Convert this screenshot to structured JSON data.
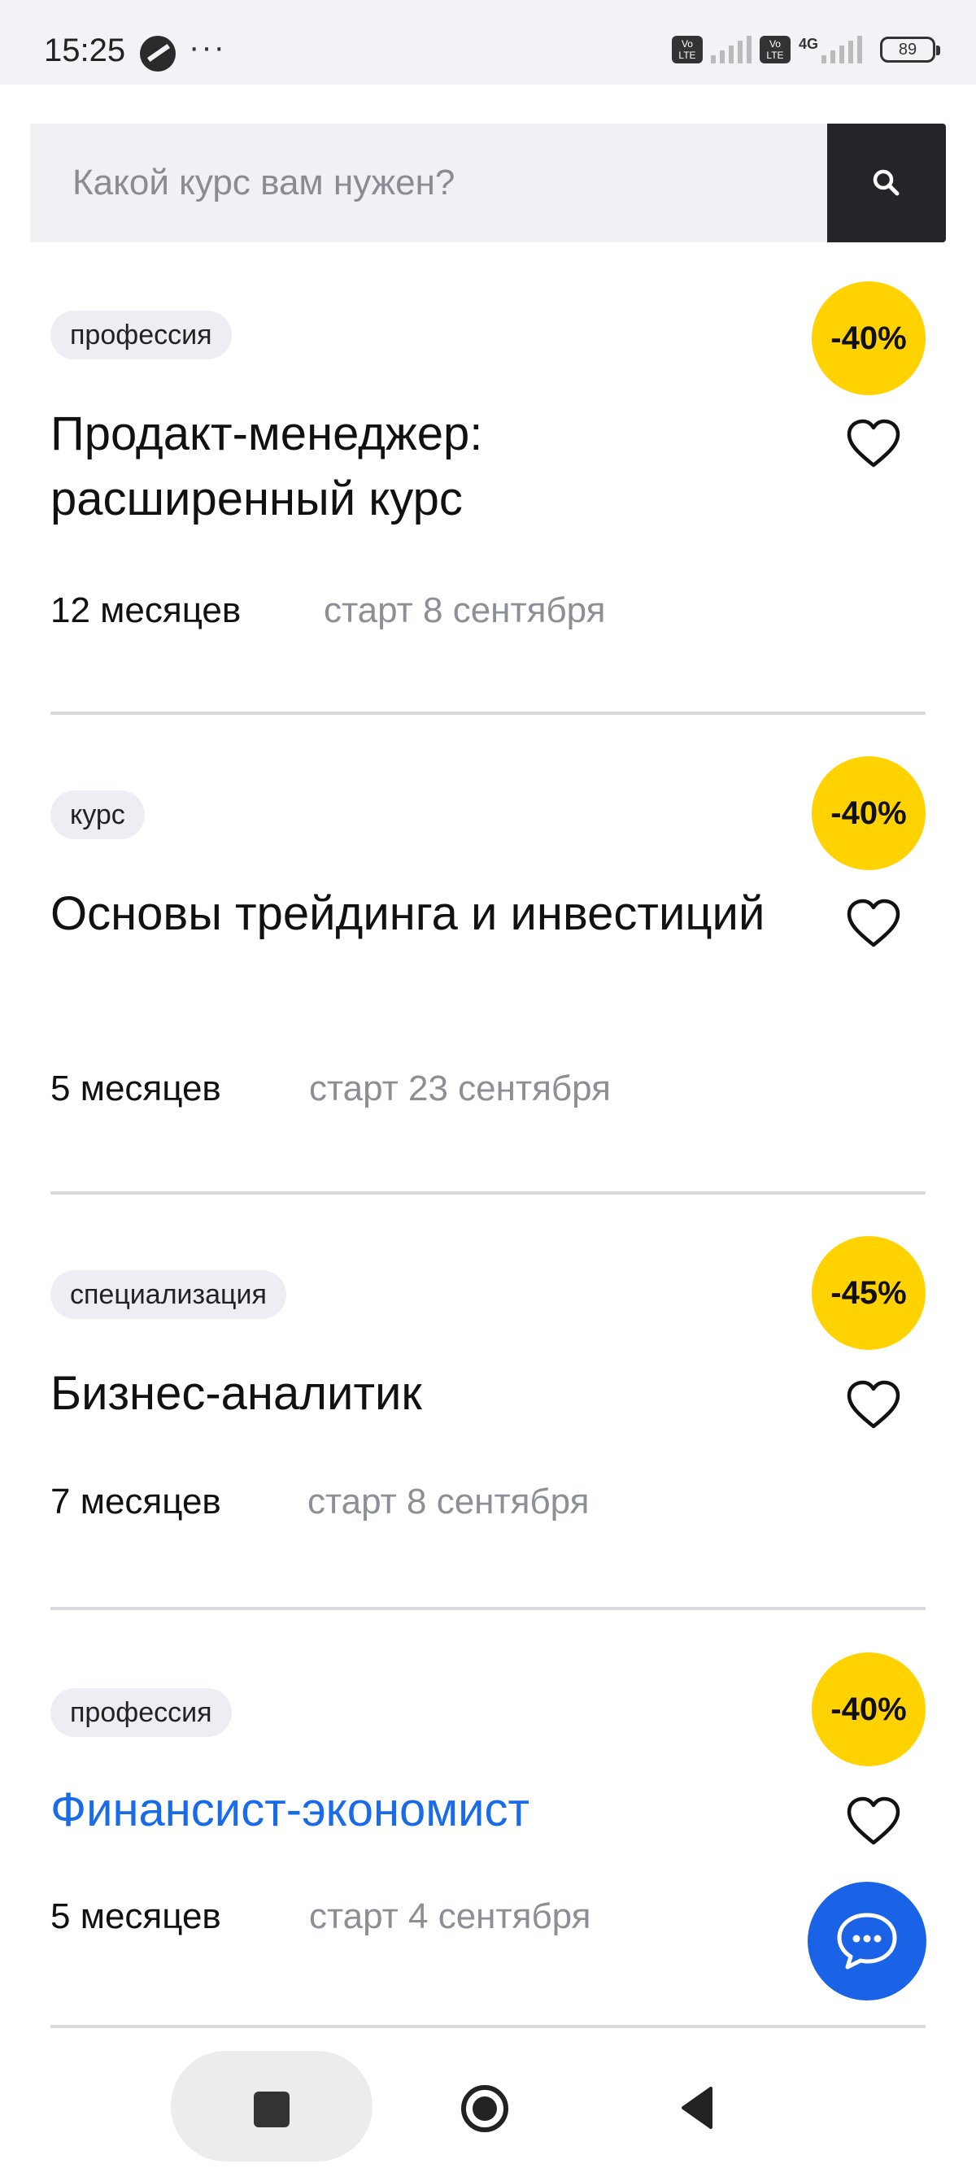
{
  "status_bar": {
    "time": "15:25",
    "more": "···",
    "volte1": "Vo LTE",
    "volte2": "Vo LTE",
    "network": "4G",
    "battery": "89"
  },
  "search": {
    "placeholder": "Какой курс вам нужен?",
    "button_icon": "search-icon"
  },
  "courses": [
    {
      "tag": "профессия",
      "discount": "-40%",
      "title": "Продакт-менеджер: расширенный курс",
      "duration": "12 месяцев",
      "start": "старт 8 сентября",
      "highlighted": false
    },
    {
      "tag": "курс",
      "discount": "-40%",
      "title": "Основы трейдинга и инвестиций",
      "duration": "5 месяцев",
      "start": "старт 23 сентября",
      "highlighted": false
    },
    {
      "tag": "специализация",
      "discount": "-45%",
      "title": "Бизнес-аналитик",
      "duration": "7 месяцев",
      "start": "старт 8 сентября",
      "highlighted": false
    },
    {
      "tag": "профессия",
      "discount": "-40%",
      "title": "Финансист-экономист",
      "duration": "5 месяцев",
      "start": "старт 4 сентября",
      "highlighted": true
    }
  ],
  "colors": {
    "discount_badge": "#ffd200",
    "link_title": "#1a6be8",
    "chat_button": "#1a63e6",
    "search_button": "#242528"
  }
}
